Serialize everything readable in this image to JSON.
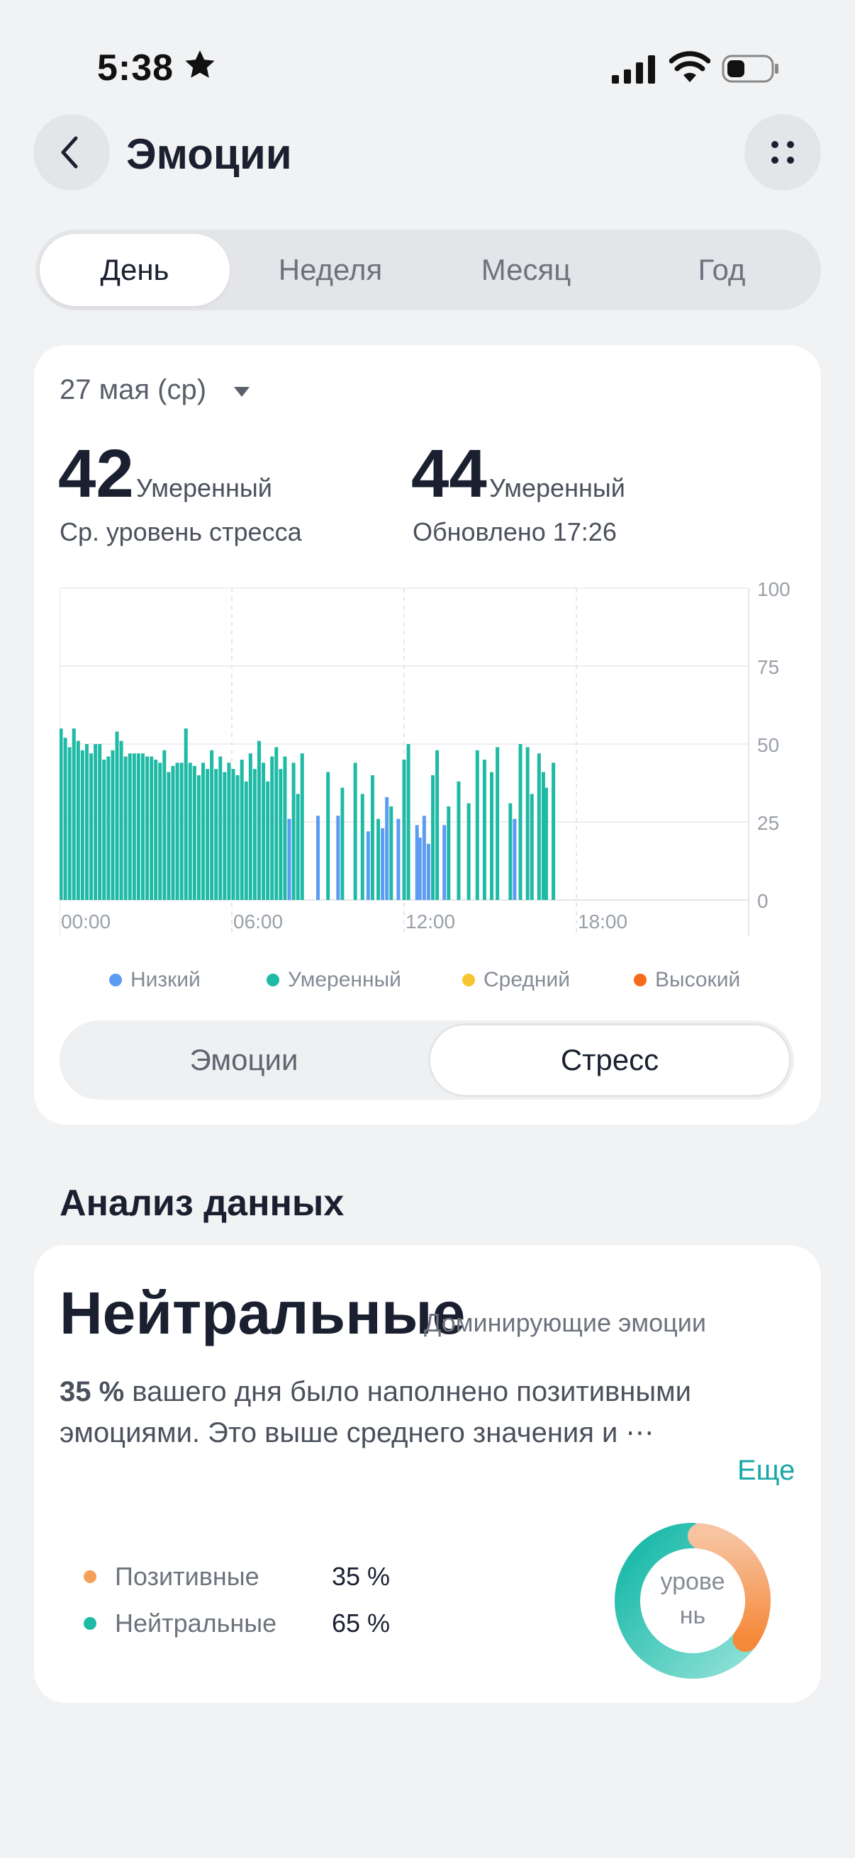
{
  "status_bar": {
    "time": "5:38",
    "icons": [
      "star-icon",
      "signal-icon",
      "wifi-icon",
      "battery-icon"
    ]
  },
  "header": {
    "title": "Эмоции",
    "back_icon": "chevron-left-icon",
    "menu_icon": "more-dots-icon"
  },
  "tabs": [
    {
      "label": "День",
      "active": true
    },
    {
      "label": "Неделя",
      "active": false
    },
    {
      "label": "Месяц",
      "active": false
    },
    {
      "label": "Год",
      "active": false
    }
  ],
  "summary": {
    "date": "27 мая (ср)",
    "avg_value": "42",
    "avg_level": "Умеренный",
    "avg_label": "Ср. уровень стресса",
    "latest_value": "44",
    "latest_level": "Умеренный",
    "latest_label": "Обновлено 17:26"
  },
  "colors": {
    "low": "#5b9cf2",
    "moderate": "#1fbaa6",
    "medium": "#f7c531",
    "high": "#f56a1c",
    "accent": "#17a8a8",
    "positive": "#f5a05a"
  },
  "legend": [
    {
      "label": "Низкий",
      "color": "#5b9cf2"
    },
    {
      "label": "Умеренный",
      "color": "#1fbaa6"
    },
    {
      "label": "Средний",
      "color": "#f7c531"
    },
    {
      "label": "Высокий",
      "color": "#f56a1c"
    }
  ],
  "chart_data": {
    "type": "bar",
    "x_ticks": [
      "00:00",
      "06:00",
      "12:00",
      "18:00"
    ],
    "y_ticks": [
      "100",
      "75",
      "50",
      "25",
      "0"
    ],
    "xlim": [
      0,
      24
    ],
    "ylim": [
      0,
      100
    ],
    "grid": true,
    "points": [
      [
        0.05,
        55,
        "m"
      ],
      [
        0.2,
        52,
        "m"
      ],
      [
        0.35,
        49,
        "m"
      ],
      [
        0.5,
        55,
        "m"
      ],
      [
        0.65,
        51,
        "m"
      ],
      [
        0.8,
        48,
        "m"
      ],
      [
        0.95,
        50,
        "m"
      ],
      [
        1.1,
        47,
        "m"
      ],
      [
        1.25,
        50,
        "m"
      ],
      [
        1.4,
        50,
        "m"
      ],
      [
        1.55,
        45,
        "m"
      ],
      [
        1.7,
        46,
        "m"
      ],
      [
        1.85,
        48,
        "m"
      ],
      [
        2.0,
        54,
        "m"
      ],
      [
        2.15,
        51,
        "m"
      ],
      [
        2.3,
        46,
        "m"
      ],
      [
        2.45,
        47,
        "m"
      ],
      [
        2.6,
        47,
        "m"
      ],
      [
        2.75,
        47,
        "m"
      ],
      [
        2.9,
        47,
        "m"
      ],
      [
        3.05,
        46,
        "m"
      ],
      [
        3.2,
        46,
        "m"
      ],
      [
        3.35,
        45,
        "m"
      ],
      [
        3.5,
        44,
        "m"
      ],
      [
        3.65,
        48,
        "m"
      ],
      [
        3.8,
        41,
        "m"
      ],
      [
        3.95,
        43,
        "m"
      ],
      [
        4.1,
        44,
        "m"
      ],
      [
        4.25,
        44,
        "m"
      ],
      [
        4.4,
        55,
        "m"
      ],
      [
        4.55,
        44,
        "m"
      ],
      [
        4.7,
        43,
        "m"
      ],
      [
        4.85,
        40,
        "m"
      ],
      [
        5.0,
        44,
        "m"
      ],
      [
        5.15,
        42,
        "m"
      ],
      [
        5.3,
        48,
        "m"
      ],
      [
        5.45,
        42,
        "m"
      ],
      [
        5.6,
        46,
        "m"
      ],
      [
        5.75,
        41,
        "m"
      ],
      [
        5.9,
        44,
        "m"
      ],
      [
        6.05,
        42,
        "m"
      ],
      [
        6.2,
        40,
        "m"
      ],
      [
        6.35,
        45,
        "m"
      ],
      [
        6.5,
        38,
        "m"
      ],
      [
        6.65,
        47,
        "m"
      ],
      [
        6.8,
        42,
        "m"
      ],
      [
        6.95,
        51,
        "m"
      ],
      [
        7.1,
        44,
        "m"
      ],
      [
        7.25,
        38,
        "m"
      ],
      [
        7.4,
        46,
        "m"
      ],
      [
        7.55,
        49,
        "m"
      ],
      [
        7.7,
        42,
        "m"
      ],
      [
        7.85,
        46,
        "m"
      ],
      [
        8.0,
        26,
        "l"
      ],
      [
        8.15,
        44,
        "m"
      ],
      [
        8.3,
        34,
        "m"
      ],
      [
        8.45,
        47,
        "m"
      ],
      [
        9.0,
        27,
        "l"
      ],
      [
        9.35,
        41,
        "m"
      ],
      [
        9.7,
        27,
        "l"
      ],
      [
        9.85,
        36,
        "m"
      ],
      [
        10.3,
        44,
        "m"
      ],
      [
        10.55,
        34,
        "m"
      ],
      [
        10.75,
        22,
        "l"
      ],
      [
        10.9,
        40,
        "m"
      ],
      [
        11.1,
        26,
        "m"
      ],
      [
        11.25,
        23,
        "l"
      ],
      [
        11.4,
        33,
        "l"
      ],
      [
        11.55,
        30,
        "m"
      ],
      [
        11.8,
        26,
        "l"
      ],
      [
        12.0,
        45,
        "m"
      ],
      [
        12.15,
        50,
        "m"
      ],
      [
        12.45,
        24,
        "l"
      ],
      [
        12.55,
        20,
        "l"
      ],
      [
        12.7,
        27,
        "l"
      ],
      [
        12.85,
        18,
        "l"
      ],
      [
        13.0,
        40,
        "m"
      ],
      [
        13.15,
        48,
        "m"
      ],
      [
        13.4,
        24,
        "l"
      ],
      [
        13.55,
        30,
        "m"
      ],
      [
        13.9,
        38,
        "m"
      ],
      [
        14.25,
        31,
        "m"
      ],
      [
        14.55,
        48,
        "m"
      ],
      [
        14.8,
        45,
        "m"
      ],
      [
        15.05,
        41,
        "m"
      ],
      [
        15.25,
        49,
        "m"
      ],
      [
        15.7,
        31,
        "m"
      ],
      [
        15.85,
        26,
        "l"
      ],
      [
        16.05,
        50,
        "m"
      ],
      [
        16.3,
        49,
        "m"
      ],
      [
        16.45,
        34,
        "m"
      ],
      [
        16.7,
        47,
        "m"
      ],
      [
        16.85,
        41,
        "m"
      ],
      [
        16.95,
        36,
        "m"
      ],
      [
        17.2,
        44,
        "m"
      ]
    ]
  },
  "mode_toggle": [
    {
      "label": "Эмоции",
      "active": false
    },
    {
      "label": "Стресс",
      "active": true
    }
  ],
  "analysis": {
    "section_title": "Анализ данных",
    "dominant": "Нейтральные",
    "dominant_sub": "Доминирующие эмоции",
    "percent": "35 %",
    "text_line1": " вашего дня было наполнено позитивными",
    "text_line2": "эмоциями. Это выше среднего значения и ⋯",
    "more": "Еще",
    "breakdown": [
      {
        "label": "Позитивные",
        "value": "35 %",
        "color": "#f5a05a"
      },
      {
        "label": "Нейтральные",
        "value": "65 %",
        "color": "#1fbaa6"
      }
    ],
    "donut_line1": "урове",
    "donut_line2": "нь",
    "donut_positive_fraction": 0.35
  }
}
